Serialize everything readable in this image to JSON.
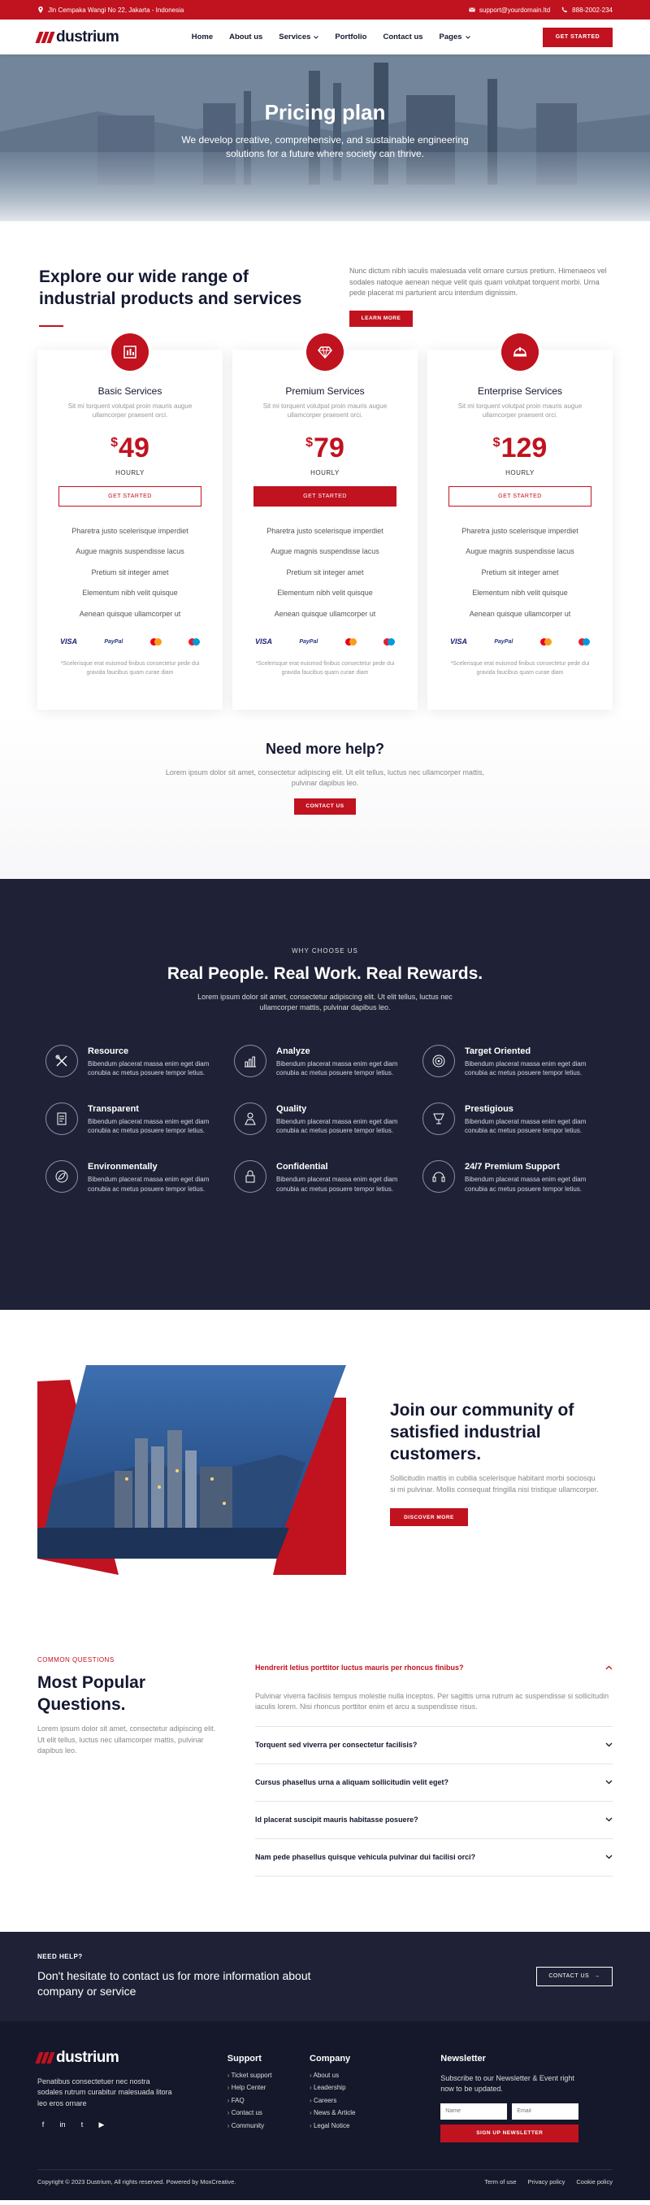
{
  "topbar": {
    "address": "Jln Cempaka Wangi No 22, Jakarta - Indonesia",
    "email": "support@yourdomain.ltd",
    "phone": "888-2002-234"
  },
  "nav": {
    "brand": "dustrium",
    "items": [
      "Home",
      "About us",
      "Services",
      "Portfolio",
      "Contact us",
      "Pages"
    ],
    "cta": "GET STARTED"
  },
  "hero": {
    "title": "Pricing plan",
    "subtitle": "We develop creative, comprehensive, and sustainable engineering solutions for a future where society can thrive."
  },
  "explore": {
    "title": "Explore our wide range of industrial products and services",
    "text": "Nunc dictum nibh iaculis malesuada velit ornare cursus pretium. Himenaeos vel sodales natoque aenean neque velit quis quam volutpat torquent morbi. Urna pede placerat mi parturient arcu interdum dignissim.",
    "cta": "LEARN MORE"
  },
  "plans": [
    {
      "name": "Basic Services",
      "desc": "Sit mi torquent volutpat proin mauris augue ullamcorper praesent orci.",
      "currency": "$",
      "price": "49",
      "period": "HOURLY",
      "cta": "GET STARTED",
      "features": [
        "Pharetra justo scelerisque imperdiet",
        "Augue magnis suspendisse lacus",
        "Pretium sit integer amet",
        "Elementum nibh velit quisque",
        "Aenean quisque ullamcorper ut"
      ],
      "payments": {
        "visa": "VISA",
        "paypal": "PayPal"
      },
      "note": "*Scelerisque erat euismod finibus consectetur pede dui gravida faucibus quam curae diam"
    },
    {
      "name": "Premium Services",
      "desc": "Sit mi torquent volutpat proin mauris augue ullamcorper praesent orci.",
      "currency": "$",
      "price": "79",
      "period": "HOURLY",
      "cta": "GET STARTED",
      "features": [
        "Pharetra justo scelerisque imperdiet",
        "Augue magnis suspendisse lacus",
        "Pretium sit integer amet",
        "Elementum nibh velit quisque",
        "Aenean quisque ullamcorper ut"
      ],
      "payments": {
        "visa": "VISA",
        "paypal": "PayPal"
      },
      "note": "*Scelerisque erat euismod finibus consectetur pede dui gravida faucibus quam curae diam"
    },
    {
      "name": "Enterprise Services",
      "desc": "Sit mi torquent volutpat proin mauris augue ullamcorper praesent orci.",
      "currency": "$",
      "price": "129",
      "period": "HOURLY",
      "cta": "GET STARTED",
      "features": [
        "Pharetra justo scelerisque imperdiet",
        "Augue magnis suspendisse lacus",
        "Pretium sit integer amet",
        "Elementum nibh velit quisque",
        "Aenean quisque ullamcorper ut"
      ],
      "payments": {
        "visa": "VISA",
        "paypal": "PayPal"
      },
      "note": "*Scelerisque erat euismod finibus consectetur pede dui gravida faucibus quam curae diam"
    }
  ],
  "help": {
    "title": "Need more help?",
    "text": "Lorem ipsum dolor sit amet, consectetur adipiscing elit. Ut elit tellus, luctus nec ullamcorper mattis, pulvinar dapibus leo.",
    "cta": "CONTACT US"
  },
  "why": {
    "eyebrow": "WHY CHOOSE US",
    "title": "Real People. Real Work. Real Rewards.",
    "lead": "Lorem ipsum dolor sit amet, consectetur adipiscing elit. Ut elit tellus, luctus nec ullamcorper mattis, pulvinar dapibus leo.",
    "items": [
      {
        "title": "Resource",
        "text": "Bibendum placerat massa enim eget diam conubia ac metus posuere tempor letius."
      },
      {
        "title": "Analyze",
        "text": "Bibendum placerat massa enim eget diam conubia ac metus posuere tempor letius."
      },
      {
        "title": "Target Oriented",
        "text": "Bibendum placerat massa enim eget diam conubia ac metus posuere tempor letius."
      },
      {
        "title": "Transparent",
        "text": "Bibendum placerat massa enim eget diam conubia ac metus posuere tempor letius."
      },
      {
        "title": "Quality",
        "text": "Bibendum placerat massa enim eget diam conubia ac metus posuere tempor letius."
      },
      {
        "title": "Prestigious",
        "text": "Bibendum placerat massa enim eget diam conubia ac metus posuere tempor letius."
      },
      {
        "title": "Environmentally",
        "text": "Bibendum placerat massa enim eget diam conubia ac metus posuere tempor letius."
      },
      {
        "title": "Confidential",
        "text": "Bibendum placerat massa enim eget diam conubia ac metus posuere tempor letius."
      },
      {
        "title": "24/7 Premium Support",
        "text": "Bibendum placerat massa enim eget diam conubia ac metus posuere tempor letius."
      }
    ]
  },
  "community": {
    "title": "Join our community of satisfied industrial customers.",
    "text": "Sollicitudin mattis in cubilia scelerisque habitant morbi sociosqu si mi pulvinar. Mollis consequat fringilla nisi tristique ullamcorper.",
    "cta": "DISCOVER MORE"
  },
  "faq": {
    "eyebrow": "COMMON QUESTIONS",
    "title": "Most Popular Questions.",
    "text": "Lorem ipsum dolor sit amet, consectetur adipiscing elit. Ut elit tellus, luctus nec ullamcorper mattis, pulvinar dapibus leo.",
    "items": [
      {
        "q": "Hendrerit letius porttitor luctus mauris per rhoncus finibus?",
        "a": "Pulvinar viverra facilisis tempus molestie nulla inceptos. Per sagittis urna rutrum ac suspendisse si sollicitudin iaculis lorem. Nisi rhoncus porttitor enim et arcu a suspendisse risus."
      },
      {
        "q": "Torquent sed viverra per consectetur facilisis?",
        "a": ""
      },
      {
        "q": "Cursus phasellus urna a aliquam sollicitudin velit eget?",
        "a": ""
      },
      {
        "q": "Id placerat suscipit mauris habitasse posuere?",
        "a": ""
      },
      {
        "q": "Nam pede phasellus quisque vehicula pulvinar dui facilisi orci?",
        "a": ""
      }
    ]
  },
  "contact": {
    "eyebrow": "NEED HELP?",
    "title": "Don't hesitate to contact us for more information about company or service",
    "cta": "CONTACT US"
  },
  "footer": {
    "brand": "dustrium",
    "about": "Penatibus consectetuer nec nostra sodales rutrum curabitur malesuada litora leo eros ornare",
    "socials": [
      "f",
      "in",
      "t",
      "▶"
    ],
    "support": {
      "title": "Support",
      "links": [
        "Ticket support",
        "Help Center",
        "FAQ",
        "Contact us",
        "Community"
      ]
    },
    "company": {
      "title": "Company",
      "links": [
        "About us",
        "Leadership",
        "Careers",
        "News & Article",
        "Legal Notice"
      ]
    },
    "newsletter": {
      "title": "Newsletter",
      "text": "Subscribe to our Newsletter & Event right now to be updated.",
      "name_placeholder": "Name",
      "email_placeholder": "Email",
      "cta": "SIGN UP NEWSLETTER"
    },
    "copyright": "Copyright © 2023 Dustrium, All rights reserved. Powered by MoxCreative.",
    "legal": [
      "Term of use",
      "Privacy policy",
      "Cookie policy"
    ]
  },
  "colors": {
    "accent": "#c1121f",
    "dark": "#1f2236",
    "footer": "#15182a"
  }
}
